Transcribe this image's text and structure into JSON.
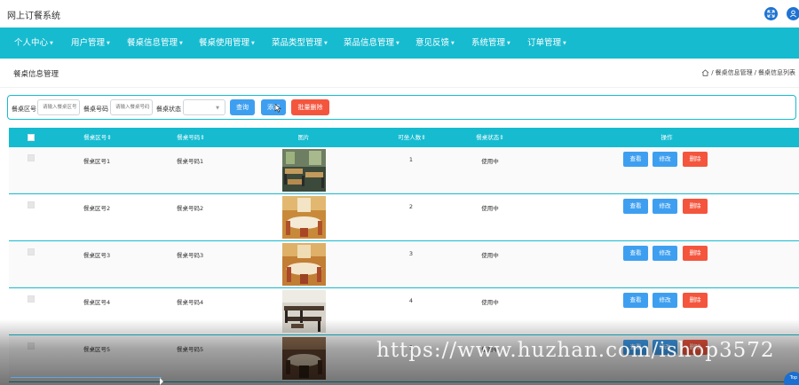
{
  "app": {
    "title": "网上订餐系统"
  },
  "top_icons": [
    "expand-icon",
    "user-icon"
  ],
  "nav": {
    "items": [
      {
        "label": "个人中心"
      },
      {
        "label": "用户管理"
      },
      {
        "label": "餐桌信息管理"
      },
      {
        "label": "餐桌使用管理"
      },
      {
        "label": "菜品类型管理"
      },
      {
        "label": "菜品信息管理"
      },
      {
        "label": "意见反馈"
      },
      {
        "label": "系统管理"
      },
      {
        "label": "订单管理"
      }
    ]
  },
  "page": {
    "heading": "餐桌信息管理",
    "breadcrumb": [
      "餐桌信息管理",
      "餐桌信息列表"
    ]
  },
  "search": {
    "zone_label": "餐桌区号",
    "zone_placeholder": "请输入餐桌区号",
    "code_label": "餐桌号码",
    "code_placeholder": "请输入餐桌号码",
    "status_label": "餐桌状态",
    "status_value": "",
    "query_button": "查询",
    "add_button": "添加",
    "batch_delete_button": "批量删除"
  },
  "table": {
    "headers": [
      "餐桌区号",
      "餐桌号码",
      "图片",
      "可坐人数",
      "餐桌状态",
      "操作"
    ],
    "action_labels": {
      "view": "查看",
      "edit": "修改",
      "delete": "删除"
    },
    "rows": [
      {
        "zone": "餐桌区号1",
        "code": "餐桌号码1",
        "seats": "1",
        "status": "使用中"
      },
      {
        "zone": "餐桌区号2",
        "code": "餐桌号码2",
        "seats": "2",
        "status": "使用中"
      },
      {
        "zone": "餐桌区号3",
        "code": "餐桌号码3",
        "seats": "3",
        "status": "使用中"
      },
      {
        "zone": "餐桌区号4",
        "code": "餐桌号码4",
        "seats": "4",
        "status": "使用中"
      },
      {
        "zone": "餐桌区号5",
        "code": "餐桌号码5",
        "seats": "5",
        "status": "使用中"
      }
    ]
  },
  "watermark": "https://www.huzhan.com/ishop3572",
  "back_to_top": "Top",
  "colors": {
    "primary": "#16bbd0",
    "button_blue": "#3e9ff0",
    "button_red": "#f4553d"
  }
}
